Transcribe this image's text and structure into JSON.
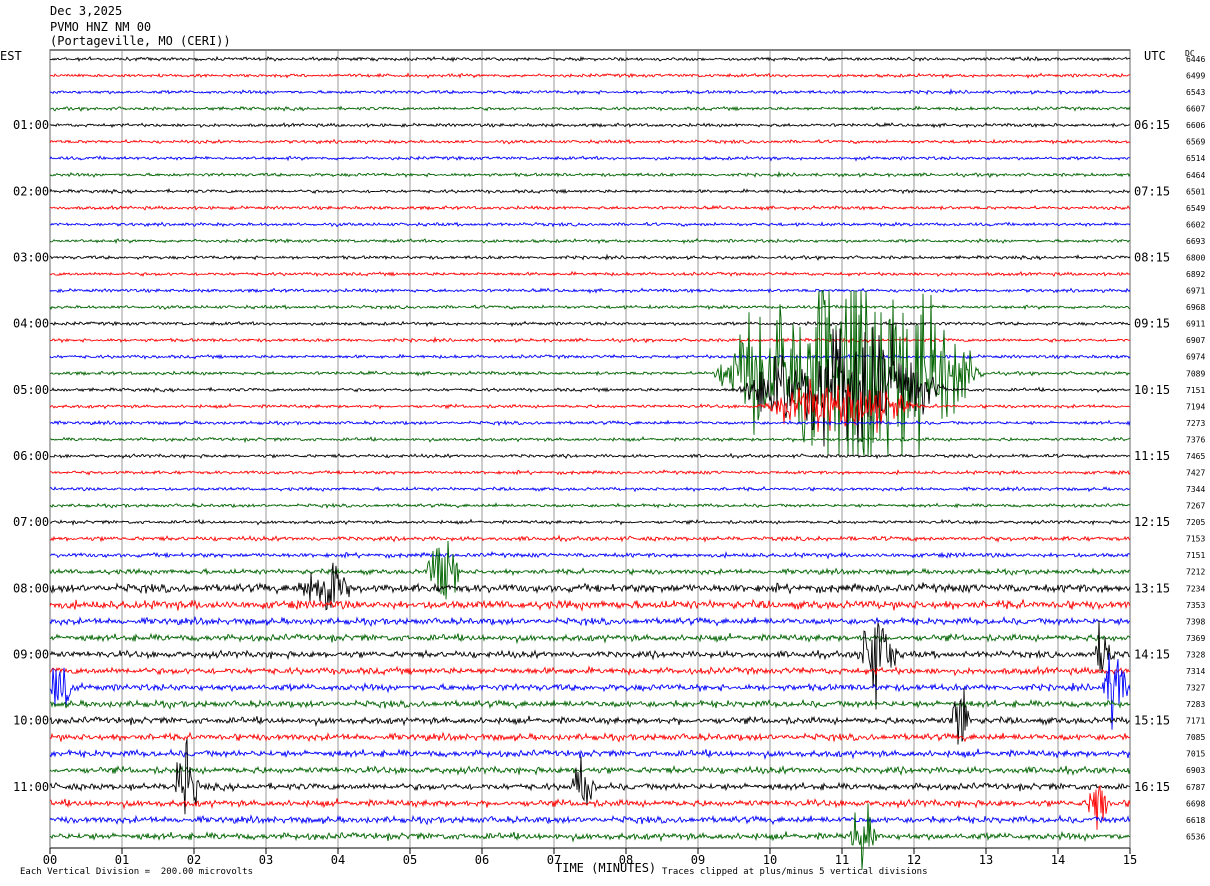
{
  "header": {
    "date": "Dec 3,2025",
    "station": "PVMO HNZ NM 00",
    "location": "(Portageville, MO (CERI))"
  },
  "left_zone": "EST",
  "right_zone": "UTC",
  "dc_label": "DC",
  "footer": {
    "scale": "Each Vertical Division =  200.00 microvolts",
    "clip": "Traces clipped at plus/minus 5 vertical divisions"
  },
  "colors": {
    "trace_cycle": [
      "#000000",
      "#ff0000",
      "#0000ff",
      "#006400"
    ],
    "grid": "#808080"
  },
  "chart_data": {
    "type": "line",
    "xlabel": "TIME (MINUTES)",
    "xlim": [
      0,
      15
    ],
    "x_ticks": [
      "00",
      "01",
      "02",
      "03",
      "04",
      "05",
      "06",
      "07",
      "08",
      "09",
      "10",
      "11",
      "12",
      "13",
      "14",
      "15"
    ],
    "trace_minutes": 15,
    "left_hour_labels": [
      "01:00",
      "02:00",
      "03:00",
      "04:00",
      "05:00",
      "06:00",
      "07:00",
      "08:00",
      "09:00",
      "10:00",
      "11:00"
    ],
    "right_hour_labels": [
      "06:15",
      "07:15",
      "08:15",
      "09:15",
      "10:15",
      "11:15",
      "12:15",
      "13:15",
      "14:15",
      "15:15",
      "16:15"
    ],
    "dc_offsets": [
      6446,
      6499,
      6543,
      6607,
      6606,
      6569,
      6514,
      6464,
      6501,
      6549,
      6602,
      6693,
      6800,
      6892,
      6971,
      6968,
      6911,
      6907,
      6974,
      7089,
      7151,
      7194,
      7273,
      7376,
      7465,
      7427,
      7344,
      7267,
      7205,
      7153,
      7151,
      7212,
      7234,
      7353,
      7398,
      7369,
      7328,
      7314,
      7327,
      7283,
      7171,
      7085,
      7015,
      6903,
      6787,
      6698,
      6618,
      6536
    ],
    "noise_level": [
      1,
      1,
      1,
      1,
      1,
      1,
      1,
      1,
      1,
      1,
      1,
      1,
      1,
      1,
      1,
      1,
      1,
      1,
      1,
      1,
      1,
      1,
      1,
      1,
      1,
      1,
      1,
      1,
      1,
      1.3,
      1.3,
      1.5,
      2.5,
      2.5,
      2,
      2,
      2,
      2,
      2,
      2,
      2,
      2,
      2,
      2,
      2,
      2,
      2,
      2
    ],
    "events": [
      {
        "trace": 19,
        "start": 9.2,
        "end": 13.0,
        "peak_divs": 6
      },
      {
        "trace": 20,
        "start": 9.5,
        "end": 12.5,
        "peak_divs": 3
      },
      {
        "trace": 21,
        "start": 9.8,
        "end": 12.1,
        "peak_divs": 1.5
      },
      {
        "trace": 32,
        "start": 3.4,
        "end": 4.2,
        "peak_divs": 2
      },
      {
        "trace": 31,
        "start": 5.2,
        "end": 5.7,
        "peak_divs": 2
      },
      {
        "trace": 36,
        "start": 11.2,
        "end": 11.8,
        "peak_divs": 2.5
      },
      {
        "trace": 36,
        "start": 14.5,
        "end": 14.8,
        "peak_divs": 2
      },
      {
        "trace": 38,
        "start": 0.0,
        "end": 0.3,
        "peak_divs": 3
      },
      {
        "trace": 38,
        "start": 14.6,
        "end": 15.0,
        "peak_divs": 2
      },
      {
        "trace": 40,
        "start": 12.5,
        "end": 12.8,
        "peak_divs": 2
      },
      {
        "trace": 44,
        "start": 1.7,
        "end": 2.1,
        "peak_divs": 2
      },
      {
        "trace": 44,
        "start": 7.2,
        "end": 7.6,
        "peak_divs": 1.5
      },
      {
        "trace": 45,
        "start": 14.4,
        "end": 14.7,
        "peak_divs": 2
      },
      {
        "trace": 47,
        "start": 11.1,
        "end": 11.5,
        "peak_divs": 2
      }
    ]
  }
}
